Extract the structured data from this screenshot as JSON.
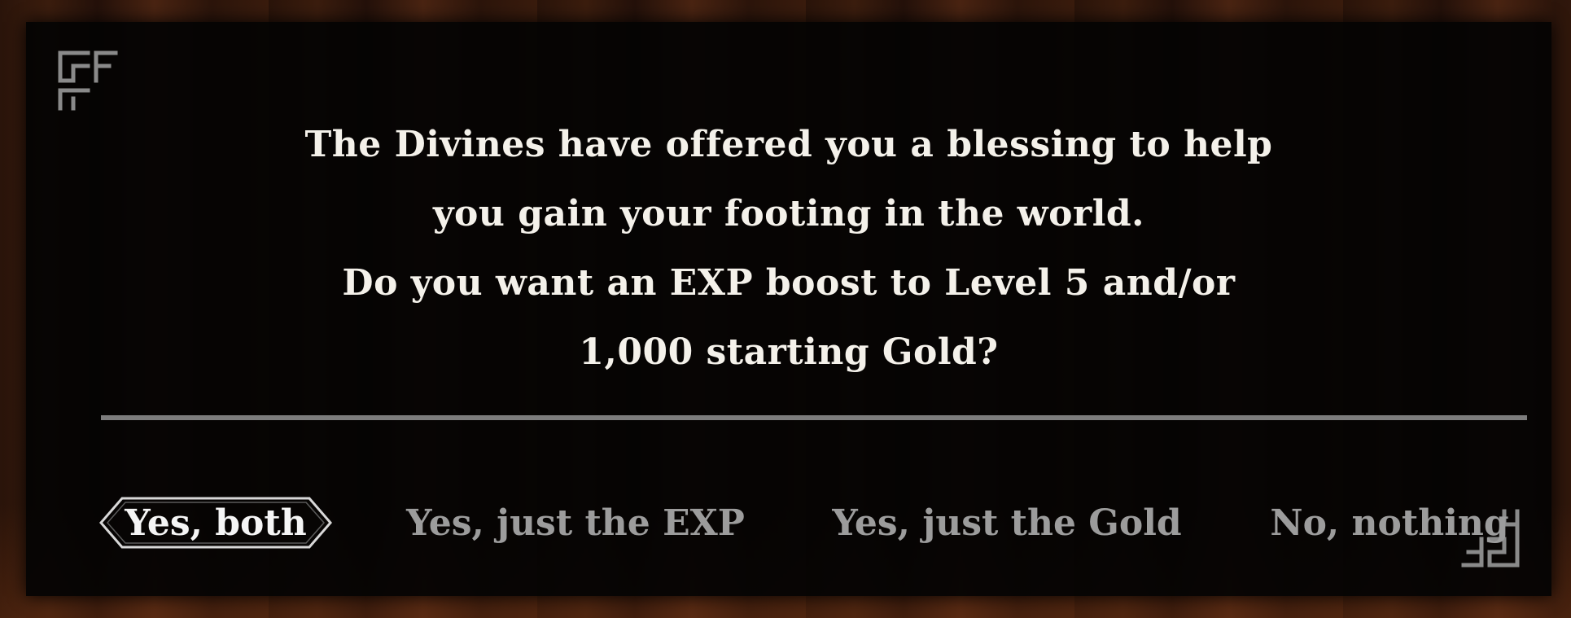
{
  "dialog": {
    "message_lines": [
      "The Divines have offered you a blessing to help",
      "you gain your footing in the world.",
      "Do you want an EXP boost to Level 5 and/or",
      "1,000 starting Gold?"
    ]
  },
  "options": [
    {
      "label": "Yes, both",
      "selected": true
    },
    {
      "label": "Yes, just the EXP",
      "selected": false
    },
    {
      "label": "Yes, just the Gold",
      "selected": false
    },
    {
      "label": "No, nothing",
      "selected": false
    }
  ],
  "colors": {
    "panel": "#030303",
    "text": "#f4f1ea",
    "option_inactive": "#9c9c9c",
    "divider": "#7d7d7d"
  },
  "icons": {
    "corner_top_left": "maze-corner-ornament-icon",
    "corner_bottom_right": "maze-corner-ornament-icon",
    "selection_frame": "arrow-bracket-frame-icon"
  }
}
